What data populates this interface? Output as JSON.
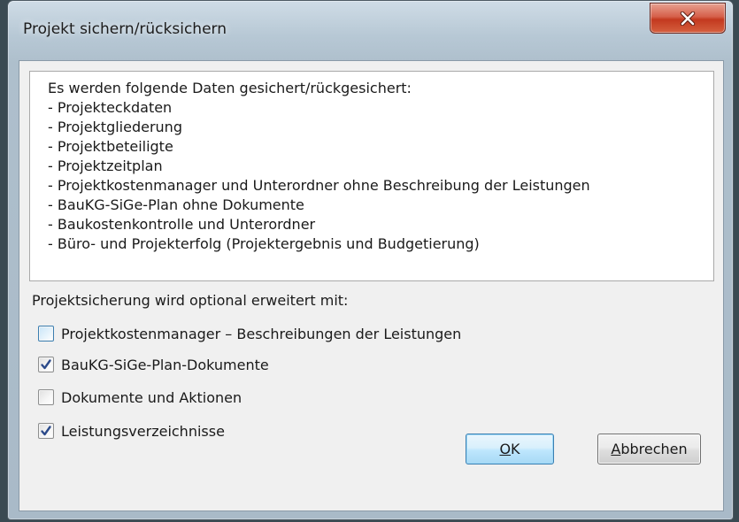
{
  "window": {
    "title": "Projekt sichern/rücksichern",
    "close_icon": "close-x-icon"
  },
  "info": {
    "heading": "Es werden folgende Daten gesichert/rückgesichert:",
    "items": [
      "- Projekteckdaten",
      "- Projektgliederung",
      "- Projektbeteiligte",
      "- Projektzeitplan",
      "- Projektkostenmanager und Unterordner ohne Beschreibung der Leistungen",
      "- BauKG-SiGe-Plan ohne Dokumente",
      "- Baukostenkontrolle und Unterordner",
      "- Büro- und Projekterfolg (Projektergebnis und Budgetierung)"
    ]
  },
  "options": {
    "label": "Projektsicherung wird optional erweitert mit:",
    "checkboxes": [
      {
        "label": "Projektkostenmanager – Beschreibungen der Leistungen",
        "checked": false
      },
      {
        "label": "BauKG-SiGe-Plan-Dokumente",
        "checked": true
      },
      {
        "label": "Dokumente und Aktionen",
        "checked": false
      },
      {
        "label": "Leistungsverzeichnisse",
        "checked": true
      }
    ]
  },
  "buttons": {
    "ok": {
      "access_key": "O",
      "rest": "K"
    },
    "cancel": {
      "access_key": "A",
      "rest": "bbrechen"
    }
  },
  "colors": {
    "accent": "#3c7fb1",
    "close_button": "#c3391f",
    "check_mark": "#2b4a8a"
  }
}
